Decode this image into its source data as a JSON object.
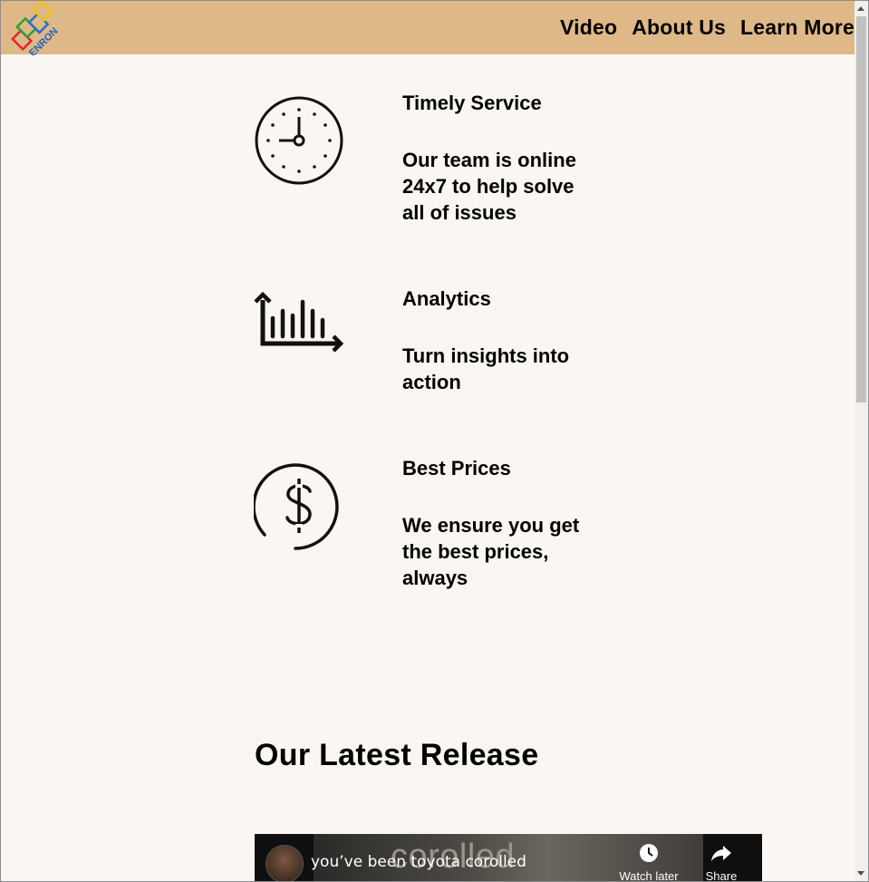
{
  "header": {
    "logo_text": "ENRON",
    "nav": [
      {
        "label": "Video"
      },
      {
        "label": "About Us"
      },
      {
        "label": "Learn More"
      }
    ]
  },
  "features": [
    {
      "icon": "clock-icon",
      "title": "Timely Service",
      "description": "Our team is online 24x7 to help solve all of issues"
    },
    {
      "icon": "analytics-chart-icon",
      "title": "Analytics",
      "description": "Turn insights into action"
    },
    {
      "icon": "dollar-icon",
      "title": "Best Prices",
      "description": "We ensure you get the best prices, always"
    }
  ],
  "release": {
    "heading": "Our Latest Release",
    "video": {
      "title": "you’ve been toyota corolled",
      "background_text": "corolled",
      "watch_later_label": "Watch later",
      "share_label": "Share"
    }
  },
  "colors": {
    "header_bg": "#dfb887",
    "page_bg": "#faf7f3",
    "text": "#000000"
  }
}
